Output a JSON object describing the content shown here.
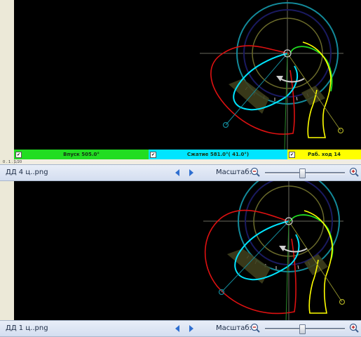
{
  "colors": {
    "canvas_bg": "#000000",
    "intake": "#22dd22",
    "compression": "#00e5ff",
    "power": "#ffff00",
    "exhaust": "#dd1111",
    "olive": "#6a6a2a",
    "teal": "#138a9a",
    "navy": "#1a1a60"
  },
  "icons": {
    "prev": "triangle-left",
    "next": "triangle-right",
    "zoom_out": "magnifier-minus",
    "zoom_in": "magnifier-plus"
  },
  "top_pane": {
    "phases": [
      {
        "label": "Впуск 505.0°",
        "checked": true
      },
      {
        "label": "Сжатие 581.0°( 41.0°)",
        "checked": true
      },
      {
        "label": "Раб. ход 14",
        "checked": true
      }
    ],
    "small_text": "0 . 1 . 1/20",
    "status": {
      "file_name": "ДД 4 ц..png",
      "scale_label": "Масштаб:",
      "zoom_fraction": 0.46
    }
  },
  "bottom_pane": {
    "status": {
      "file_name": "ДД 1 ц..png",
      "scale_label": "Масштаб:",
      "zoom_fraction": 0.46
    }
  }
}
